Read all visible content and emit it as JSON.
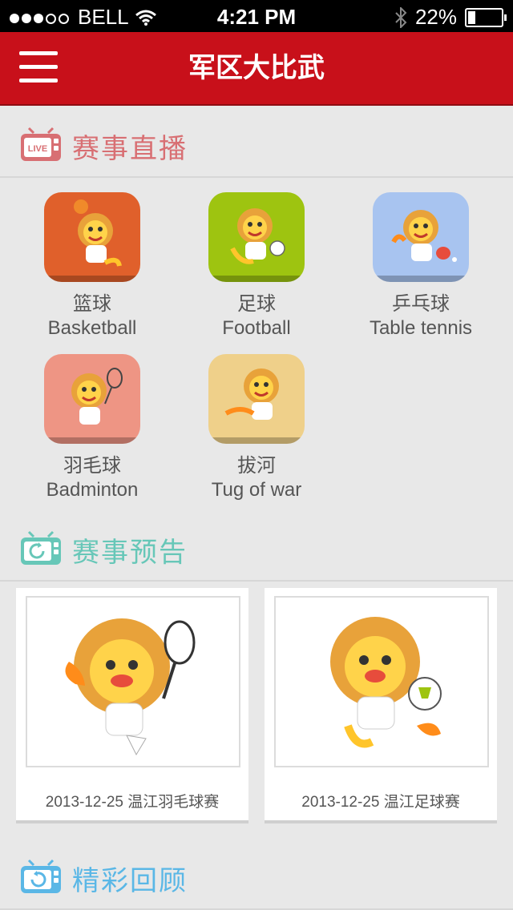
{
  "status_bar": {
    "carrier": "BELL",
    "time": "4:21 PM",
    "battery": "22%"
  },
  "nav": {
    "title": "军区大比武"
  },
  "sections": {
    "live": {
      "title": "赛事直播",
      "color": "#d86f73",
      "badge": "LIVE"
    },
    "preview": {
      "title": "赛事预告",
      "color": "#67c7b8"
    },
    "review": {
      "title": "精彩回顾",
      "color": "#5ab7e6"
    }
  },
  "sports": [
    {
      "cn": "篮球",
      "en": "Basketball",
      "color": "#e0602b"
    },
    {
      "cn": "足球",
      "en": "Football",
      "color": "#9ec410"
    },
    {
      "cn": "乒乓球",
      "en": "Table tennis",
      "color": "#a8c4f0"
    },
    {
      "cn": "羽毛球",
      "en": "Badminton",
      "color": "#ee9584"
    },
    {
      "cn": "拔河",
      "en": "Tug of war",
      "color": "#efd08a"
    }
  ],
  "previews": [
    {
      "caption": "2013-12-25  温江羽毛球赛"
    },
    {
      "caption": "2013-12-25  温江足球赛"
    }
  ]
}
